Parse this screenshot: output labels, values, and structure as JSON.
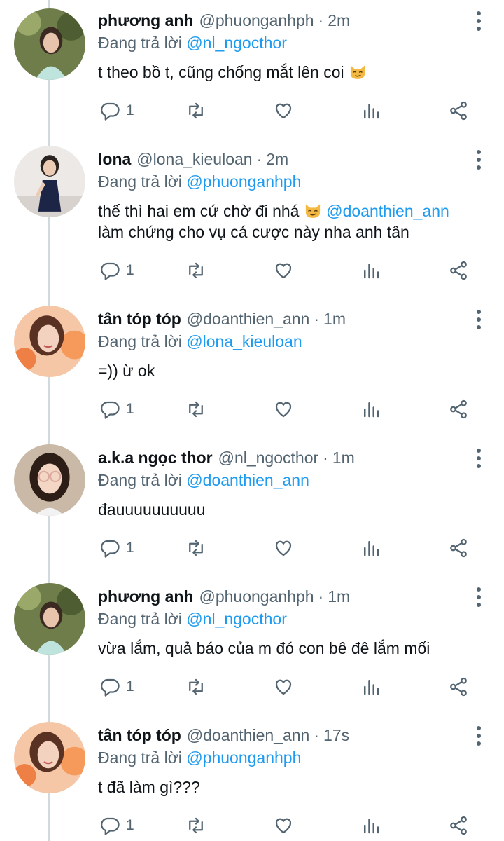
{
  "tweets": [
    {
      "name": "phương anh",
      "handle": "@phuonganhph",
      "time": "2m",
      "reply_prefix": "Đang trả lời",
      "reply_to": "@nl_ngocthor",
      "text_lines": [
        "t theo bồ t, cũng chống mắt lên coi"
      ],
      "has_cat_emoji": true,
      "reply_count": "1",
      "avatar_icon": "avatar-phuong-anh"
    },
    {
      "name": "lona",
      "handle": "@lona_kieuloan",
      "time": "2m",
      "reply_prefix": "Đang trả lời",
      "reply_to": "@phuonganhph",
      "text_lines": [
        "thế thì hai em cứ chờ đi nhá",
        "làm chứng cho vụ cá cược này nha anh tân"
      ],
      "mention_in_text": "@doanthien_ann",
      "reply_count": "1",
      "avatar_icon": "avatar-lona"
    },
    {
      "name": "tân tóp tóp",
      "handle": "@doanthien_ann",
      "time": "1m",
      "reply_prefix": "Đang trả lời",
      "reply_to": "@lona_kieuloan",
      "text_lines": [
        "=)) ừ ok"
      ],
      "reply_count": "1",
      "avatar_icon": "avatar-tan-top-top"
    },
    {
      "name": "a.k.a ngọc thor",
      "handle": "@nl_ngocthor",
      "time": "1m",
      "reply_prefix": "Đang trả lời",
      "reply_to": "@doanthien_ann",
      "text_lines": [
        "đauuuuuuuuuu"
      ],
      "reply_count": "1",
      "avatar_icon": "avatar-ngoc-thor"
    },
    {
      "name": "phương anh",
      "handle": "@phuonganhph",
      "time": "1m",
      "reply_prefix": "Đang trả lời",
      "reply_to": "@nl_ngocthor",
      "text_lines": [
        "vừa lắm, quả báo của m đó con bê đê lắm mối"
      ],
      "reply_count": "1",
      "avatar_icon": "avatar-phuong-anh"
    },
    {
      "name": "tân tóp tóp",
      "handle": "@doanthien_ann",
      "time": "17s",
      "reply_prefix": "Đang trả lời",
      "reply_to": "@phuonganhph",
      "text_lines": [
        "t đã làm gì???"
      ],
      "reply_count": "1",
      "avatar_icon": "avatar-tan-top-top"
    }
  ],
  "colors": {
    "link": "#1d9bf0",
    "secondary": "#536471",
    "primary_text": "#0f1419",
    "thread_line": "#cfd9de"
  },
  "icons": [
    "reply-icon",
    "retweet-icon",
    "like-icon",
    "views-icon",
    "share-icon",
    "more-icon"
  ]
}
